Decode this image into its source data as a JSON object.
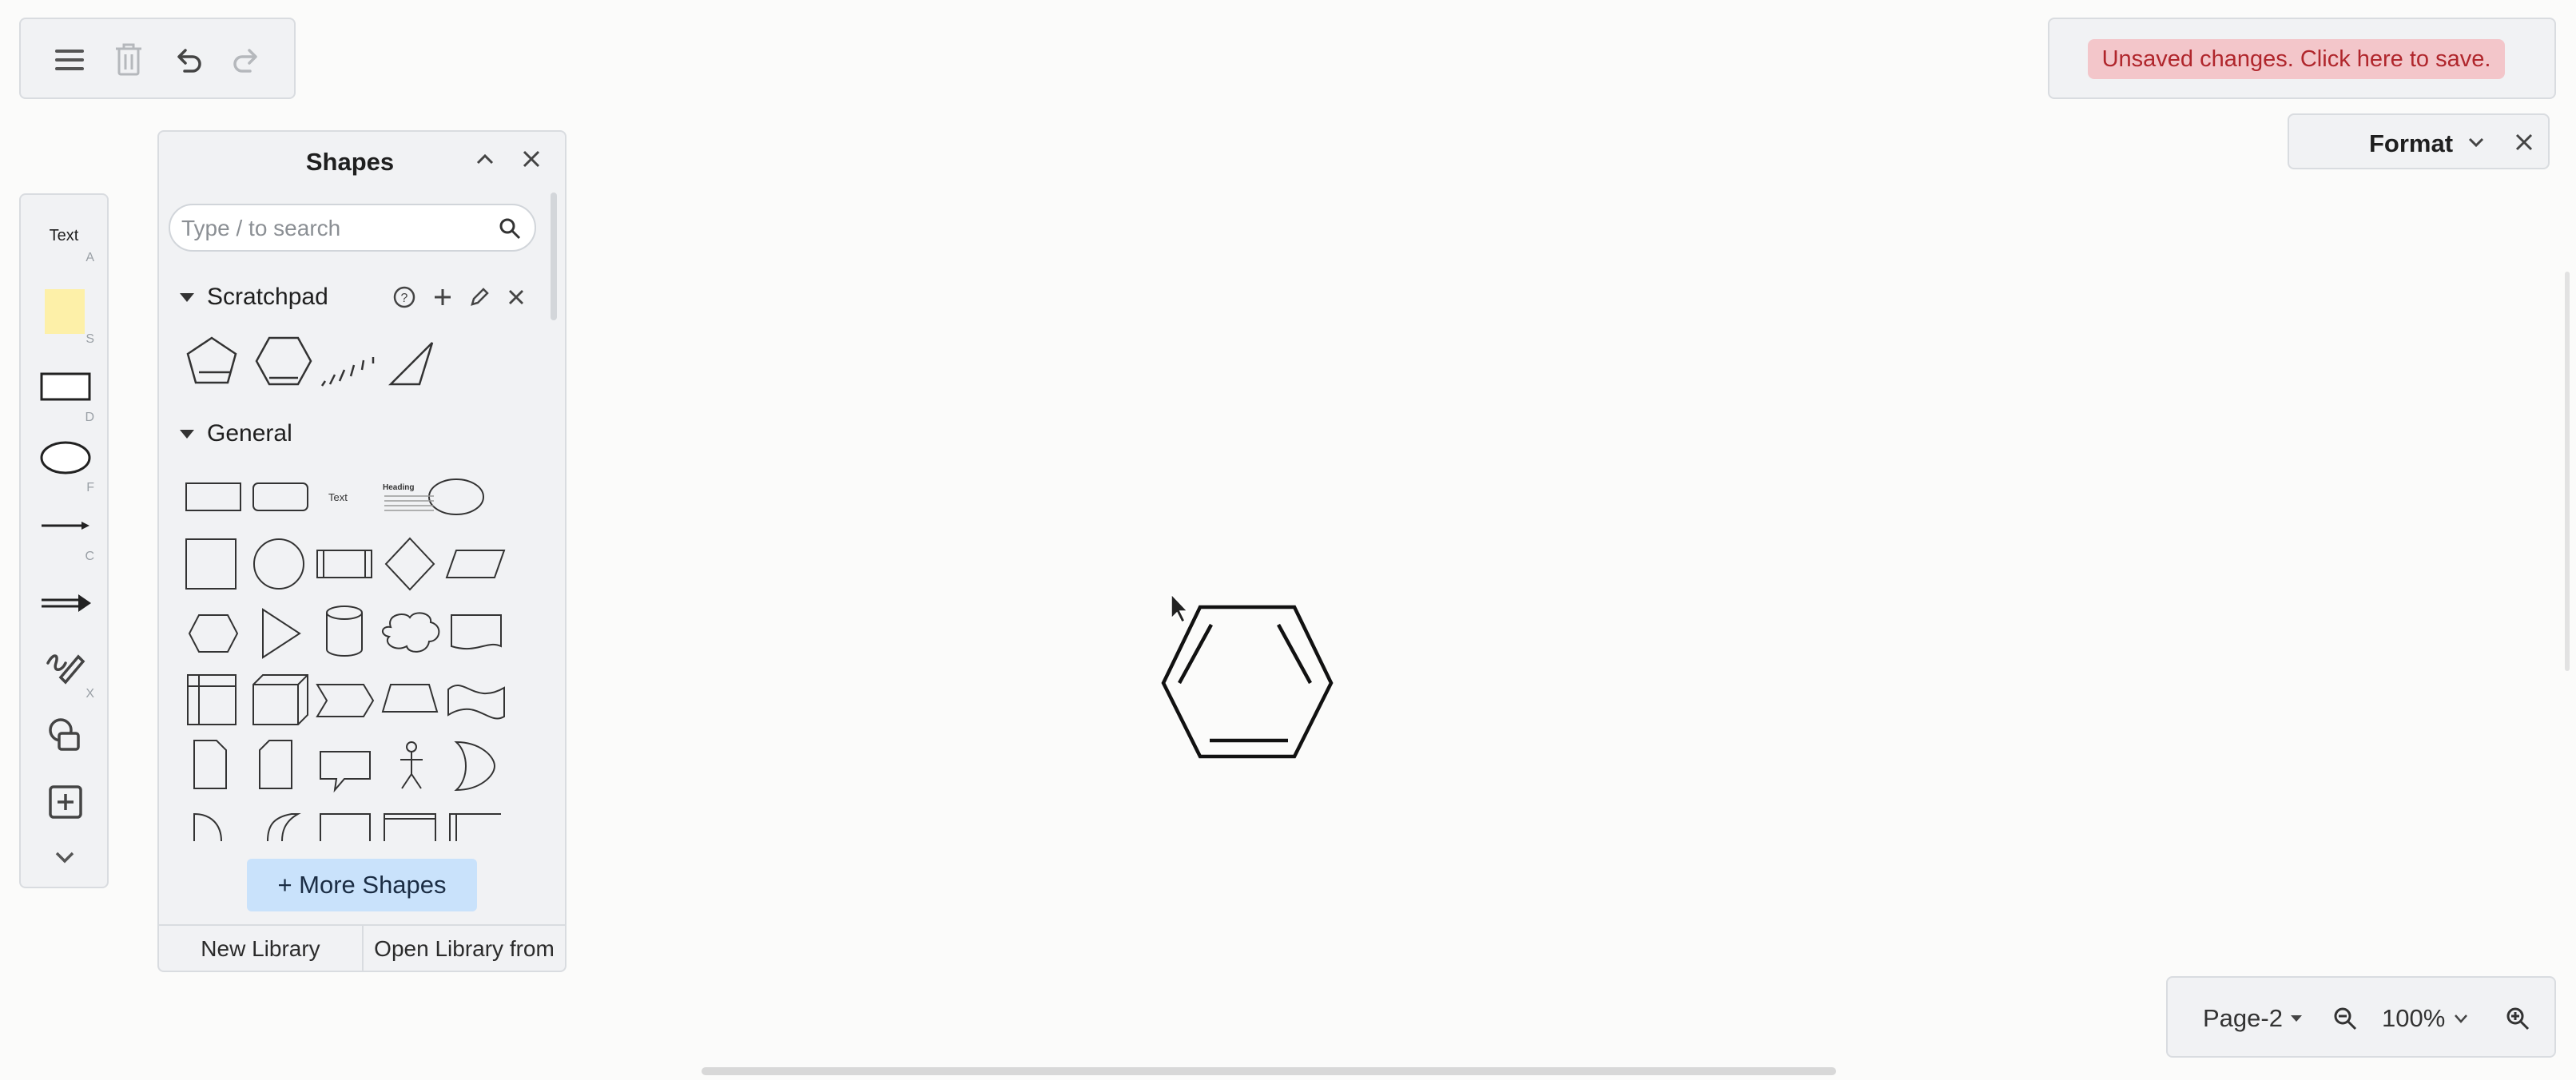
{
  "canvas": {
    "shape_name": "benzene-hexagon"
  },
  "toolbar": {
    "items": [
      {
        "name": "menu-icon"
      },
      {
        "name": "delete-icon"
      },
      {
        "name": "undo-icon"
      },
      {
        "name": "redo-icon"
      }
    ]
  },
  "save_notice": {
    "label": "Unsaved changes. Click here to save."
  },
  "format_panel": {
    "label": "Format"
  },
  "tools": {
    "text_label": "Text",
    "hints": [
      "A",
      "S",
      "D",
      "F",
      "C",
      "X"
    ]
  },
  "shapes_panel": {
    "title": "Shapes",
    "search": {
      "placeholder": "Type / to search",
      "value": ""
    },
    "scratchpad": {
      "title": "Scratchpad"
    },
    "general": {
      "title": "General",
      "text_shape": "Text",
      "heading_shape": "Heading"
    },
    "more_shapes": "+ More Shapes",
    "footer": {
      "new_library": "New Library",
      "open_library": "Open Library from"
    }
  },
  "bottom_bar": {
    "page": "Page-2",
    "zoom": "100%"
  },
  "colors": {
    "accent": "#c9e2fb",
    "unsaved_bg": "#f3c6ca",
    "unsaved_text": "#b0262c",
    "sticky_note": "#fdf0a8"
  }
}
